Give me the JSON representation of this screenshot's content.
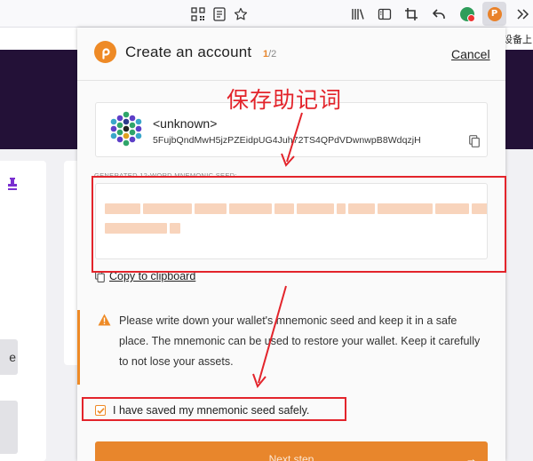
{
  "browser_toolbar": {
    "icons": [
      "qr-code-icon",
      "reader-view-icon",
      "star-icon",
      "library-icon",
      "sidebar-icon",
      "crop-icon",
      "undo-icon",
      "green-extension-icon",
      "polkadot-extension-icon",
      "overflow-icon"
    ]
  },
  "background_page": {
    "top_right_text": "设备上",
    "left_button_text": "e"
  },
  "popup": {
    "title": "Create an account",
    "step_current": "1",
    "step_total": "/2",
    "cancel_label": "Cancel",
    "account": {
      "name": "<unknown>",
      "address": "5FujbQndMwH5jzPZEidpUG4Juh72TS4QPdVDwnwpB8WdqzjH"
    },
    "seed_label": "GENERATED 12-WORD MNEMONIC SEED:",
    "copy_clipboard_label": "Copy to clipboard",
    "warning_text": "Please write down your wallet's mnemonic seed and keep it in a safe place. The mnemonic can be used to restore your wallet. Keep it carefully to not lose your assets.",
    "checkbox_label": "I have saved my mnemonic seed safely.",
    "checkbox_checked": true,
    "next_button_label": "Next step",
    "accent_color": "#e8862c"
  },
  "annotation": {
    "text": "保存助记词",
    "color": "#e3242b"
  }
}
